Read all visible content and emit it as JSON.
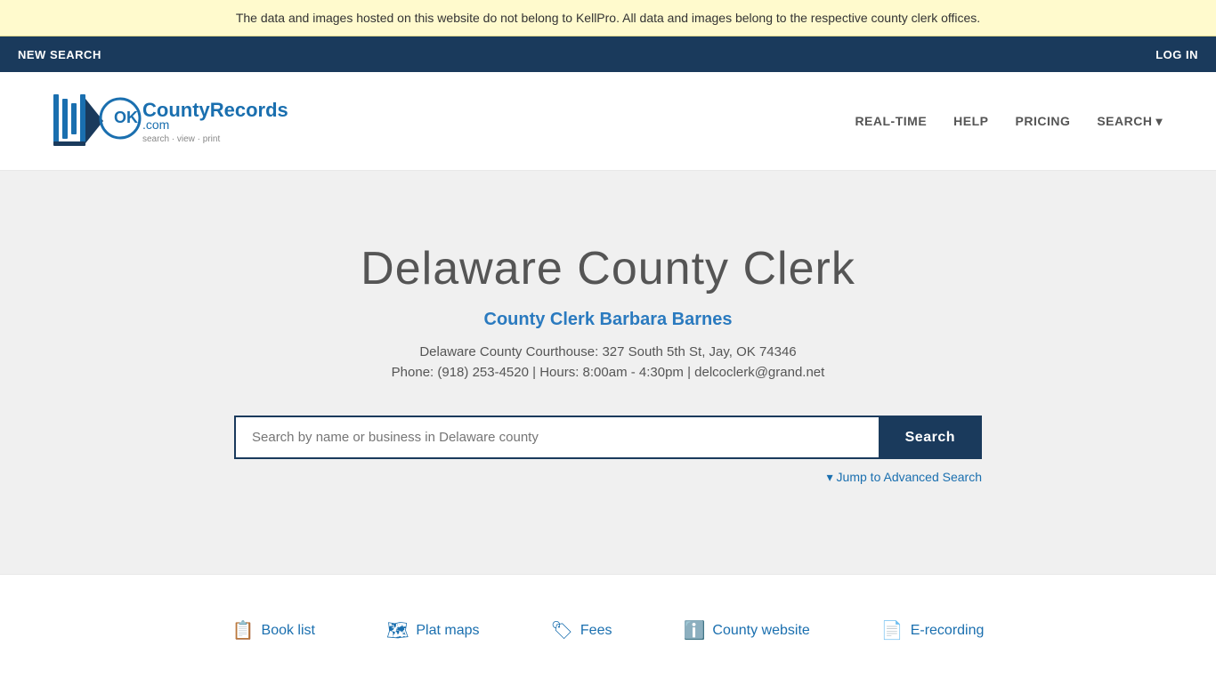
{
  "banner": {
    "text": "The data and images hosted on this website do not belong to KellPro. All data and images belong to the respective county clerk offices."
  },
  "topNav": {
    "newSearch": "NEW SEARCH",
    "login": "LOG IN"
  },
  "header": {
    "logoAlt": "OKCountyRecords.com",
    "logoTagline": "search · view · print",
    "nav": [
      {
        "label": "REAL-TIME",
        "id": "real-time"
      },
      {
        "label": "HELP",
        "id": "help"
      },
      {
        "label": "PRICING",
        "id": "pricing"
      },
      {
        "label": "SEARCH",
        "id": "search-nav"
      }
    ]
  },
  "hero": {
    "title": "Delaware County Clerk",
    "clerkName": "County Clerk Barbara Barnes",
    "address": "Delaware County Courthouse: 327 South 5th St, Jay, OK 74346",
    "contactLine": "Phone: (918) 253-4520 | Hours: 8:00am - 4:30pm | delcoclerk@grand.net",
    "searchPlaceholder": "Search by name or business in Delaware county",
    "searchButtonLabel": "Search",
    "advancedSearchLabel": "▾ Jump to Advanced Search"
  },
  "footerLinks": [
    {
      "icon": "📋",
      "label": "Book list",
      "id": "book-list"
    },
    {
      "icon": "🗺",
      "label": "Plat maps",
      "id": "plat-maps"
    },
    {
      "icon": "🏷",
      "label": "Fees",
      "id": "fees"
    },
    {
      "icon": "ℹ",
      "label": "County website",
      "id": "county-website"
    },
    {
      "icon": "📄",
      "label": "E-recording",
      "id": "e-recording"
    }
  ]
}
